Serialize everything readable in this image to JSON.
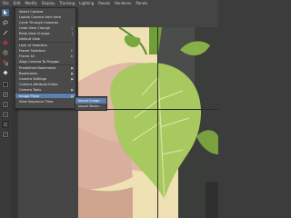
{
  "menubar": [
    "File",
    "Edit",
    "Modify",
    "Display",
    "Tracking",
    "Lighting",
    "Panels",
    "Renderer",
    "Panels"
  ],
  "menu": {
    "items": [
      {
        "label": "Select Camera",
        "shortcut": "",
        "submenu": false
      },
      {
        "label": "Lookat Camera from here",
        "shortcut": "",
        "submenu": false
      },
      {
        "label": "Cycle Through Cameras",
        "shortcut": "",
        "submenu": false
      },
      {
        "label": "Undo View Change",
        "shortcut": "[",
        "submenu": false
      },
      {
        "label": "Redo View Change",
        "shortcut": "]",
        "submenu": false
      },
      {
        "label": "Default View",
        "shortcut": "",
        "submenu": false
      },
      {
        "label": "Look at Selection",
        "shortcut": "",
        "submenu": false
      },
      {
        "label": "Frame Selection",
        "shortcut": "F",
        "submenu": false
      },
      {
        "label": "Frame All",
        "shortcut": "A",
        "submenu": false
      },
      {
        "label": "Align Camera To Polygon",
        "shortcut": "",
        "submenu": false
      },
      {
        "label": "Predefined Bookmarks",
        "shortcut": "",
        "submenu": true
      },
      {
        "label": "Bookmarks",
        "shortcut": "",
        "submenu": true
      },
      {
        "label": "Camera Settings",
        "shortcut": "",
        "submenu": true
      },
      {
        "label": "Camera Attribute Editor",
        "shortcut": "",
        "submenu": false
      },
      {
        "label": "Camera Tools",
        "shortcut": "",
        "submenu": true
      },
      {
        "label": "Image Plane",
        "shortcut": "",
        "submenu": true
      },
      {
        "label": "View Sequence Time",
        "shortcut": "",
        "submenu": false
      }
    ]
  },
  "submenu": {
    "items": [
      "Import Image...",
      "Import Movie..."
    ]
  },
  "colors": {
    "highlight": "#5b7fae",
    "leaf": "#a8c860",
    "toolbar_red": "#c0392b"
  }
}
